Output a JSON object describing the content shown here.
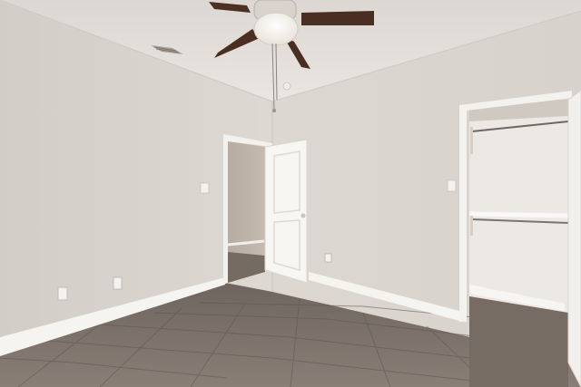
{
  "scene": {
    "type": "empty bedroom interior photo",
    "colors": {
      "ceiling": "#e4e0dc",
      "wall_left": "#d8d2cc",
      "wall_right": "#dbd6d0",
      "trim": "#f6f5f2",
      "floor_tile": "#7f756d",
      "fan_blade": "#4a2e22"
    },
    "icons": [
      "ceiling-fan-icon",
      "air-vent-icon",
      "light-switch-icon",
      "outlet-icon",
      "closet-rod-icon"
    ]
  }
}
